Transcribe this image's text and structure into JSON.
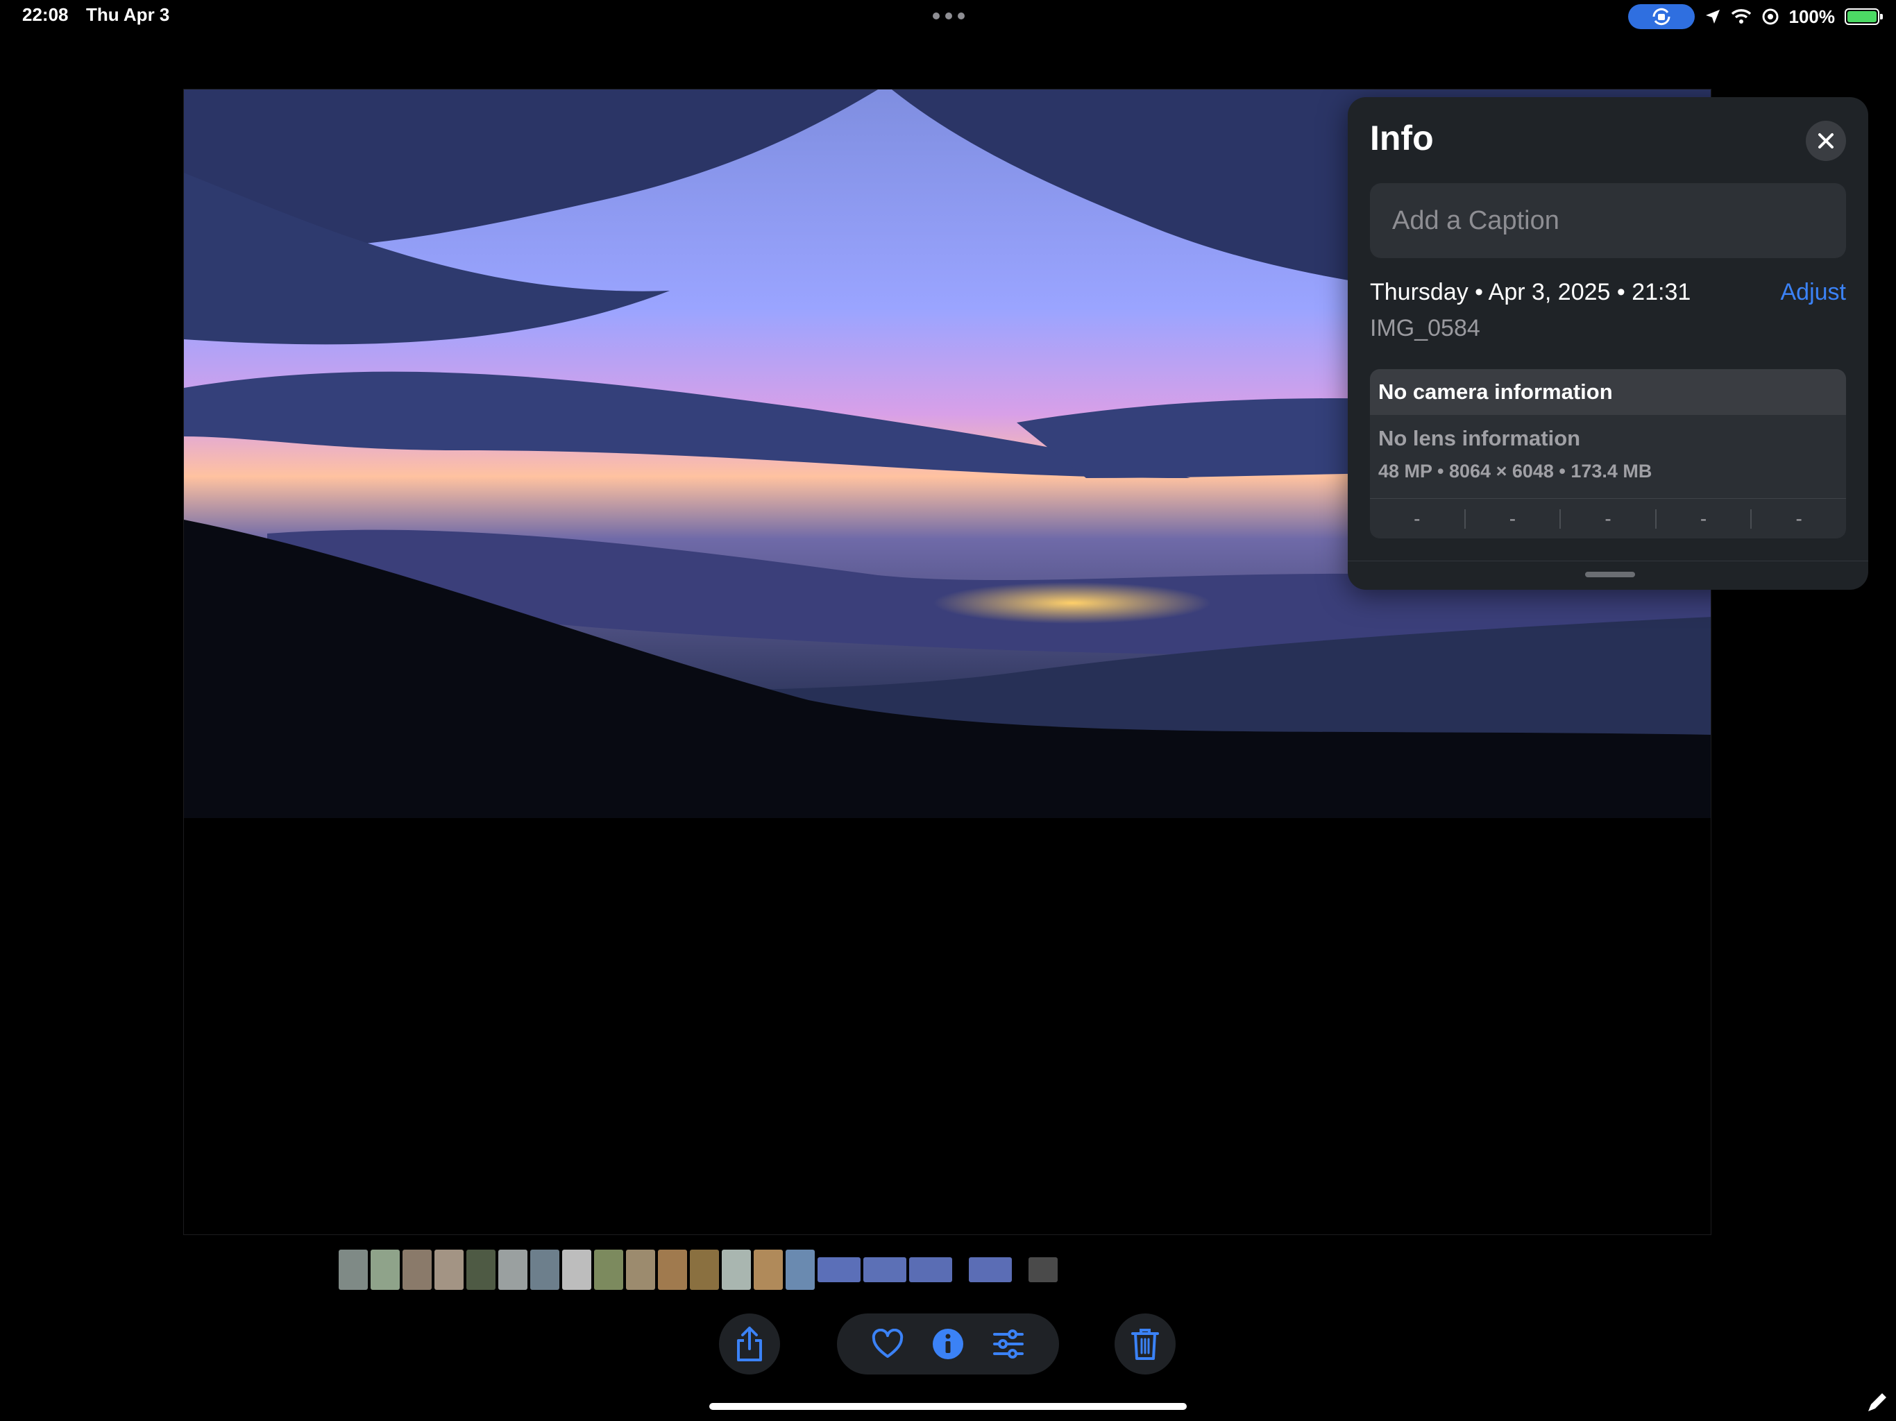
{
  "status_bar": {
    "time": "22:08",
    "date": "Thu Apr 3",
    "battery_percent": "100%",
    "icons": [
      "screen-rotation-lock-icon",
      "location-arrow-icon",
      "wifi-icon",
      "do-not-disturb-icon",
      "battery-charging-icon"
    ]
  },
  "photo": {
    "description_icon": "sunset-mountain-photo"
  },
  "info_panel": {
    "title": "Info",
    "caption_placeholder": "Add a Caption",
    "date_line": "Thursday • Apr 3, 2025 • 21:31",
    "adjust_label": "Adjust",
    "filename": "IMG_0584",
    "camera_info": "No camera information",
    "lens_info": "No lens information",
    "specs": "48 MP • 8064 × 6048 • 173.4 MB",
    "exif": [
      "-",
      "-",
      "-",
      "-",
      "-"
    ]
  },
  "thumbnails": {
    "colors": [
      "#7f8a86",
      "#8fa38a",
      "#8a7a6a",
      "#a39484",
      "#4e5a44",
      "#9aa0a0",
      "#6d7f8c",
      "#bdbdbd",
      "#7c8a5e",
      "#9c8b6e",
      "#a07a4e",
      "#8a7040",
      "#a9b6b0",
      "#b08a5a",
      "#6a8ab0",
      "#5b6fb8",
      "#5c70b6",
      "#5a6db4",
      "#5b6db5",
      "#4a4a4a"
    ]
  },
  "toolbar": {
    "share": "share-icon",
    "favorite": "heart-icon",
    "info": "info-icon",
    "edit": "sliders-icon",
    "delete": "trash-icon"
  },
  "colors": {
    "accent": "#3b82f6",
    "panel_bg": "#1f2327"
  }
}
